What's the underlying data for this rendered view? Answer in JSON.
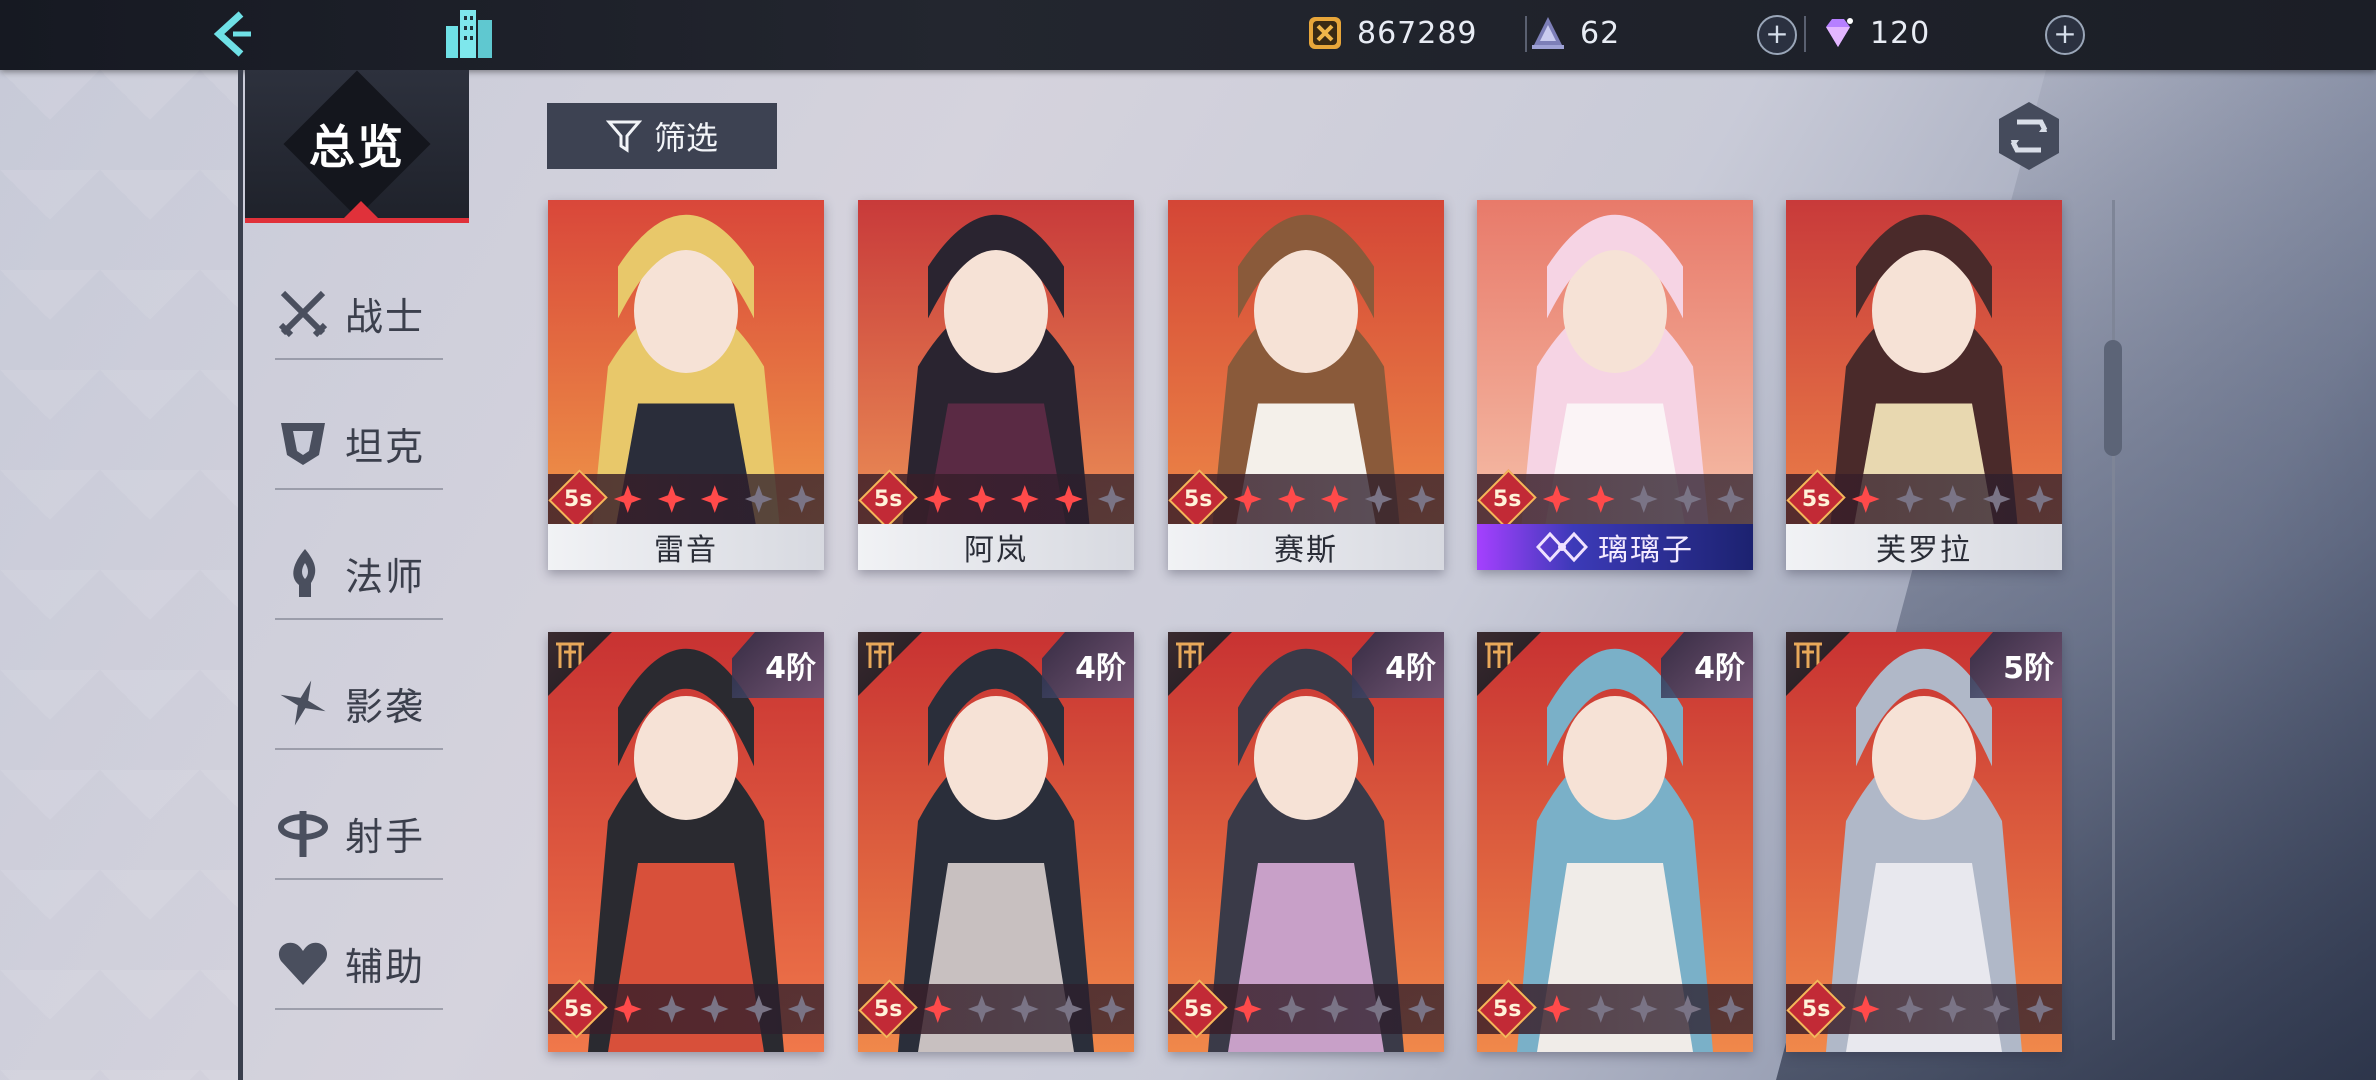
{
  "topbar": {
    "gold": "867289",
    "tickets": "62",
    "gems": "120",
    "plus": "+"
  },
  "sidebar": {
    "overview": "总览",
    "roles": [
      "战士",
      "坦克",
      "法师",
      "影袭",
      "射手",
      "辅助"
    ]
  },
  "filter_label": "筛选",
  "rank_label": "5s",
  "row1": [
    {
      "name": "雷音",
      "stars": 3,
      "special": false
    },
    {
      "name": "阿岚",
      "stars": 4,
      "special": false
    },
    {
      "name": "赛斯",
      "stars": 3,
      "special": false
    },
    {
      "name": "璃璃子",
      "stars": 2,
      "special": true
    },
    {
      "name": "芙罗拉",
      "stars": 1,
      "special": false
    }
  ],
  "row2": [
    {
      "tier": "4阶",
      "stars": 1
    },
    {
      "tier": "4阶",
      "stars": 1
    },
    {
      "tier": "4阶",
      "stars": 1
    },
    {
      "tier": "4阶",
      "stars": 1
    },
    {
      "tier": "5阶",
      "stars": 1
    }
  ],
  "colors": {
    "accent_red": "#e0313a",
    "star_lit": "#ff4a4a",
    "star_dim": "#7a7486"
  }
}
